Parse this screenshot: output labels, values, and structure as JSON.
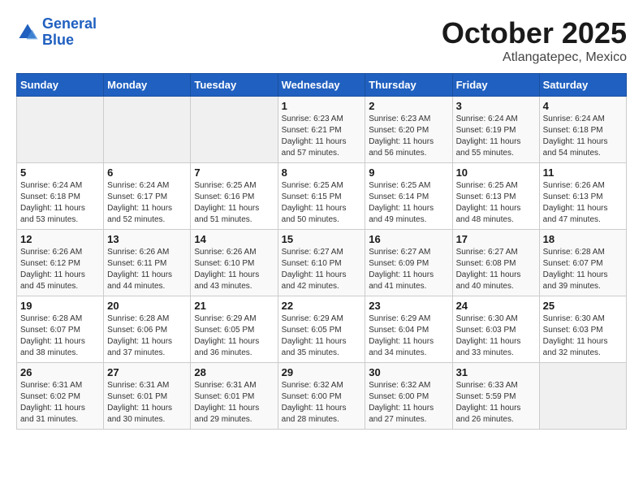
{
  "header": {
    "logo_line1": "General",
    "logo_line2": "Blue",
    "month": "October 2025",
    "location": "Atlangatepec, Mexico"
  },
  "weekdays": [
    "Sunday",
    "Monday",
    "Tuesday",
    "Wednesday",
    "Thursday",
    "Friday",
    "Saturday"
  ],
  "weeks": [
    [
      {
        "day": "",
        "info": ""
      },
      {
        "day": "",
        "info": ""
      },
      {
        "day": "",
        "info": ""
      },
      {
        "day": "1",
        "info": "Sunrise: 6:23 AM\nSunset: 6:21 PM\nDaylight: 11 hours and 57 minutes."
      },
      {
        "day": "2",
        "info": "Sunrise: 6:23 AM\nSunset: 6:20 PM\nDaylight: 11 hours and 56 minutes."
      },
      {
        "day": "3",
        "info": "Sunrise: 6:24 AM\nSunset: 6:19 PM\nDaylight: 11 hours and 55 minutes."
      },
      {
        "day": "4",
        "info": "Sunrise: 6:24 AM\nSunset: 6:18 PM\nDaylight: 11 hours and 54 minutes."
      }
    ],
    [
      {
        "day": "5",
        "info": "Sunrise: 6:24 AM\nSunset: 6:18 PM\nDaylight: 11 hours and 53 minutes."
      },
      {
        "day": "6",
        "info": "Sunrise: 6:24 AM\nSunset: 6:17 PM\nDaylight: 11 hours and 52 minutes."
      },
      {
        "day": "7",
        "info": "Sunrise: 6:25 AM\nSunset: 6:16 PM\nDaylight: 11 hours and 51 minutes."
      },
      {
        "day": "8",
        "info": "Sunrise: 6:25 AM\nSunset: 6:15 PM\nDaylight: 11 hours and 50 minutes."
      },
      {
        "day": "9",
        "info": "Sunrise: 6:25 AM\nSunset: 6:14 PM\nDaylight: 11 hours and 49 minutes."
      },
      {
        "day": "10",
        "info": "Sunrise: 6:25 AM\nSunset: 6:13 PM\nDaylight: 11 hours and 48 minutes."
      },
      {
        "day": "11",
        "info": "Sunrise: 6:26 AM\nSunset: 6:13 PM\nDaylight: 11 hours and 47 minutes."
      }
    ],
    [
      {
        "day": "12",
        "info": "Sunrise: 6:26 AM\nSunset: 6:12 PM\nDaylight: 11 hours and 45 minutes."
      },
      {
        "day": "13",
        "info": "Sunrise: 6:26 AM\nSunset: 6:11 PM\nDaylight: 11 hours and 44 minutes."
      },
      {
        "day": "14",
        "info": "Sunrise: 6:26 AM\nSunset: 6:10 PM\nDaylight: 11 hours and 43 minutes."
      },
      {
        "day": "15",
        "info": "Sunrise: 6:27 AM\nSunset: 6:10 PM\nDaylight: 11 hours and 42 minutes."
      },
      {
        "day": "16",
        "info": "Sunrise: 6:27 AM\nSunset: 6:09 PM\nDaylight: 11 hours and 41 minutes."
      },
      {
        "day": "17",
        "info": "Sunrise: 6:27 AM\nSunset: 6:08 PM\nDaylight: 11 hours and 40 minutes."
      },
      {
        "day": "18",
        "info": "Sunrise: 6:28 AM\nSunset: 6:07 PM\nDaylight: 11 hours and 39 minutes."
      }
    ],
    [
      {
        "day": "19",
        "info": "Sunrise: 6:28 AM\nSunset: 6:07 PM\nDaylight: 11 hours and 38 minutes."
      },
      {
        "day": "20",
        "info": "Sunrise: 6:28 AM\nSunset: 6:06 PM\nDaylight: 11 hours and 37 minutes."
      },
      {
        "day": "21",
        "info": "Sunrise: 6:29 AM\nSunset: 6:05 PM\nDaylight: 11 hours and 36 minutes."
      },
      {
        "day": "22",
        "info": "Sunrise: 6:29 AM\nSunset: 6:05 PM\nDaylight: 11 hours and 35 minutes."
      },
      {
        "day": "23",
        "info": "Sunrise: 6:29 AM\nSunset: 6:04 PM\nDaylight: 11 hours and 34 minutes."
      },
      {
        "day": "24",
        "info": "Sunrise: 6:30 AM\nSunset: 6:03 PM\nDaylight: 11 hours and 33 minutes."
      },
      {
        "day": "25",
        "info": "Sunrise: 6:30 AM\nSunset: 6:03 PM\nDaylight: 11 hours and 32 minutes."
      }
    ],
    [
      {
        "day": "26",
        "info": "Sunrise: 6:31 AM\nSunset: 6:02 PM\nDaylight: 11 hours and 31 minutes."
      },
      {
        "day": "27",
        "info": "Sunrise: 6:31 AM\nSunset: 6:01 PM\nDaylight: 11 hours and 30 minutes."
      },
      {
        "day": "28",
        "info": "Sunrise: 6:31 AM\nSunset: 6:01 PM\nDaylight: 11 hours and 29 minutes."
      },
      {
        "day": "29",
        "info": "Sunrise: 6:32 AM\nSunset: 6:00 PM\nDaylight: 11 hours and 28 minutes."
      },
      {
        "day": "30",
        "info": "Sunrise: 6:32 AM\nSunset: 6:00 PM\nDaylight: 11 hours and 27 minutes."
      },
      {
        "day": "31",
        "info": "Sunrise: 6:33 AM\nSunset: 5:59 PM\nDaylight: 11 hours and 26 minutes."
      },
      {
        "day": "",
        "info": ""
      }
    ]
  ]
}
